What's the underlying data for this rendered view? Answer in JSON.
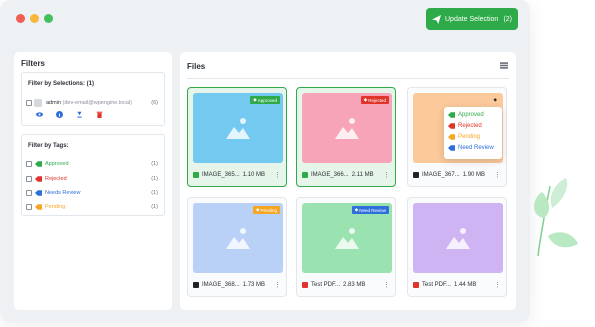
{
  "window": {
    "update_button": {
      "label": "Update Selection",
      "count": "(2)"
    }
  },
  "filters": {
    "title": "Filters",
    "selections": {
      "title": "Filter by Selections: (1)",
      "user": {
        "name": "admin",
        "email": "(dev-email@wpengine.local)",
        "count": "(6)"
      }
    },
    "tags": {
      "title": "Filter by Tags:",
      "items": [
        {
          "label": "Approved",
          "count": "(1)",
          "color": "#2eaa48"
        },
        {
          "label": "Rejected",
          "count": "(1)",
          "color": "#e0342a"
        },
        {
          "label": "Needs Review",
          "count": "(1)",
          "color": "#2f6fdb"
        },
        {
          "label": "Pending",
          "count": "(1)",
          "color": "#f5a623"
        }
      ]
    }
  },
  "files": {
    "title": "Files",
    "cards": [
      {
        "name": "IMAGE_365...",
        "size": "1.10 MB",
        "badge": "Approved",
        "badge_color": "#2eaa48",
        "thumb_color": "#73c9ef"
      },
      {
        "name": "IMAGE_366...",
        "size": "2.11 MB",
        "badge": "Rejected",
        "badge_color": "#e0342a",
        "thumb_color": "#f7a3b8"
      },
      {
        "name": "IMAGE_367...",
        "size": "1.90 MB",
        "badge": "",
        "badge_color": "#222222",
        "thumb_color": "#fbc99a"
      },
      {
        "name": "IMAGE_368...",
        "size": "1.73 MB",
        "badge": "Pending",
        "badge_color": "#f5a623",
        "thumb_color": "#b9d0f7"
      },
      {
        "name": "Test PDF...",
        "size": "2.83 MB",
        "badge": "Need Review",
        "badge_color": "#2f6fdb",
        "thumb_color": "#9be2b1"
      },
      {
        "name": "Test PDF...",
        "size": "1.44 MB",
        "badge": "",
        "badge_color": "",
        "thumb_color": "#cfb4f3"
      }
    ],
    "tag_menu": [
      {
        "label": "Approved",
        "color": "#2eaa48"
      },
      {
        "label": "Rejected",
        "color": "#e0342a"
      },
      {
        "label": "Pending",
        "color": "#f5a623"
      },
      {
        "label": "Need Review",
        "color": "#2f6fdb"
      }
    ]
  }
}
